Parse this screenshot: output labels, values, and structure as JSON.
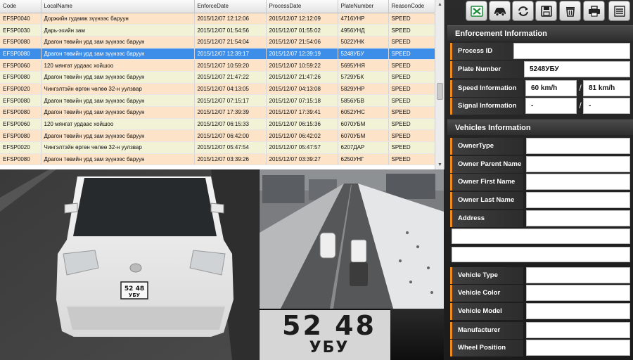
{
  "table": {
    "columns": [
      "Code",
      "LocalName",
      "EnforceDate",
      "ProcessDate",
      "PlateNumber",
      "ReasonCode"
    ],
    "selected_index": 3,
    "rows": [
      [
        "EFSP0040",
        "Доржийн гудамж зүүнээс баруун",
        "2015/12/07 12:12:06",
        "2015/12/07 12:12:09",
        "4716УНР",
        "SPEED"
      ],
      [
        "EFSP0030",
        "Дарь-эхийн зам",
        "2015/12/07 01:54:56",
        "2015/12/07 01:55:02",
        "4956УНД",
        "SPEED"
      ],
      [
        "EFSP0080",
        "Драгон төвийн урд зам зүүнээс баруун",
        "2015/12/07 21:54:04",
        "2015/12/07 21:54:06",
        "5022УНК",
        "SPEED"
      ],
      [
        "EFSP0080",
        "Драгон төвийн урд зам зүүнээс баруун",
        "2015/12/07 12:39:17",
        "2015/12/07 12:39:19",
        "5248УБУ",
        "SPEED"
      ],
      [
        "EFSP0060",
        "120 мянгат урдаас хойшоо",
        "2015/12/07 10:59:20",
        "2015/12/07 10:59:22",
        "5695УНЯ",
        "SPEED"
      ],
      [
        "EFSP0080",
        "Драгон төвийн урд зам зүүнээс баруун",
        "2015/12/07 21:47:22",
        "2015/12/07 21:47:26",
        "5729УБК",
        "SPEED"
      ],
      [
        "EFSP0020",
        "Чингэлтэйн өргөн чөлөө 32-н уулзвар",
        "2015/12/07 04:13:05",
        "2015/12/07 04:13:08",
        "5829УНР",
        "SPEED"
      ],
      [
        "EFSP0080",
        "Драгон төвийн урд зам зүүнээс баруун",
        "2015/12/07 07:15:17",
        "2015/12/07 07:15:18",
        "5856УБВ",
        "SPEED"
      ],
      [
        "EFSP0080",
        "Драгон төвийн урд зам зүүнээс баруун",
        "2015/12/07 17:39:39",
        "2015/12/07 17:39:41",
        "6052УНС",
        "SPEED"
      ],
      [
        "EFSP0060",
        "120 мянгат урдаас хойшоо",
        "2015/12/07 06:15:33",
        "2015/12/07 06:15:36",
        "6070УБМ",
        "SPEED"
      ],
      [
        "EFSP0080",
        "Драгон төвийн урд зам зүүнээс баруун",
        "2015/12/07 06:42:00",
        "2015/12/07 06:42:02",
        "6070УБМ",
        "SPEED"
      ],
      [
        "EFSP0020",
        "Чингэлтэйн өргөн чөлөө 32-н уулзвар",
        "2015/12/07 05:47:54",
        "2015/12/07 05:47:57",
        "6207ДАР",
        "SPEED"
      ],
      [
        "EFSP0080",
        "Драгон төвийн урд зам зүүнээс баруун",
        "2015/12/07 03:39:26",
        "2015/12/07 03:39:27",
        "6250УНГ",
        "SPEED"
      ]
    ]
  },
  "images": {
    "front_plate_line1": "52 48",
    "front_plate_line2": "УБУ",
    "crop_plate_line1": "52 48",
    "crop_plate_line2": "УБУ"
  },
  "toolbar": {
    "icons": [
      "excel-export-icon",
      "car-icon",
      "refresh-icon",
      "save-icon",
      "trash-icon",
      "print-icon",
      "list-icon"
    ],
    "excel_color": "#1e8a3a"
  },
  "enforcement": {
    "title": "Enforcement Information",
    "process_id_label": "Process ID",
    "process_id_value": "",
    "plate_number_label": "Plate Number",
    "plate_number_value": "5248УБУ",
    "speed_label": "Speed Information",
    "speed_value": "60 km/h",
    "speed_limit_value": "81 km/h",
    "signal_label": "Signal Information",
    "signal_value": "-",
    "signal_value_2": "-"
  },
  "vehicles": {
    "title": "Vehicles Information",
    "owner_type_label": "OwnerType",
    "owner_parent_label": "Owner Parent Name",
    "owner_first_label": "Owner First Name",
    "owner_last_label": "Owner Last Name",
    "address_label": "Address",
    "vehicle_type_label": "Vehicle Type",
    "vehicle_color_label": "Vehicle Color",
    "vehicle_model_label": "Vehicle Model",
    "manufacturer_label": "Manufacturer",
    "wheel_position_label": "Wheel Position"
  },
  "colors": {
    "accent_orange": "#f08a1c",
    "row_odd": "#fde3c7",
    "row_even": "#f2f2d7",
    "row_selected": "#3d8ee8"
  }
}
